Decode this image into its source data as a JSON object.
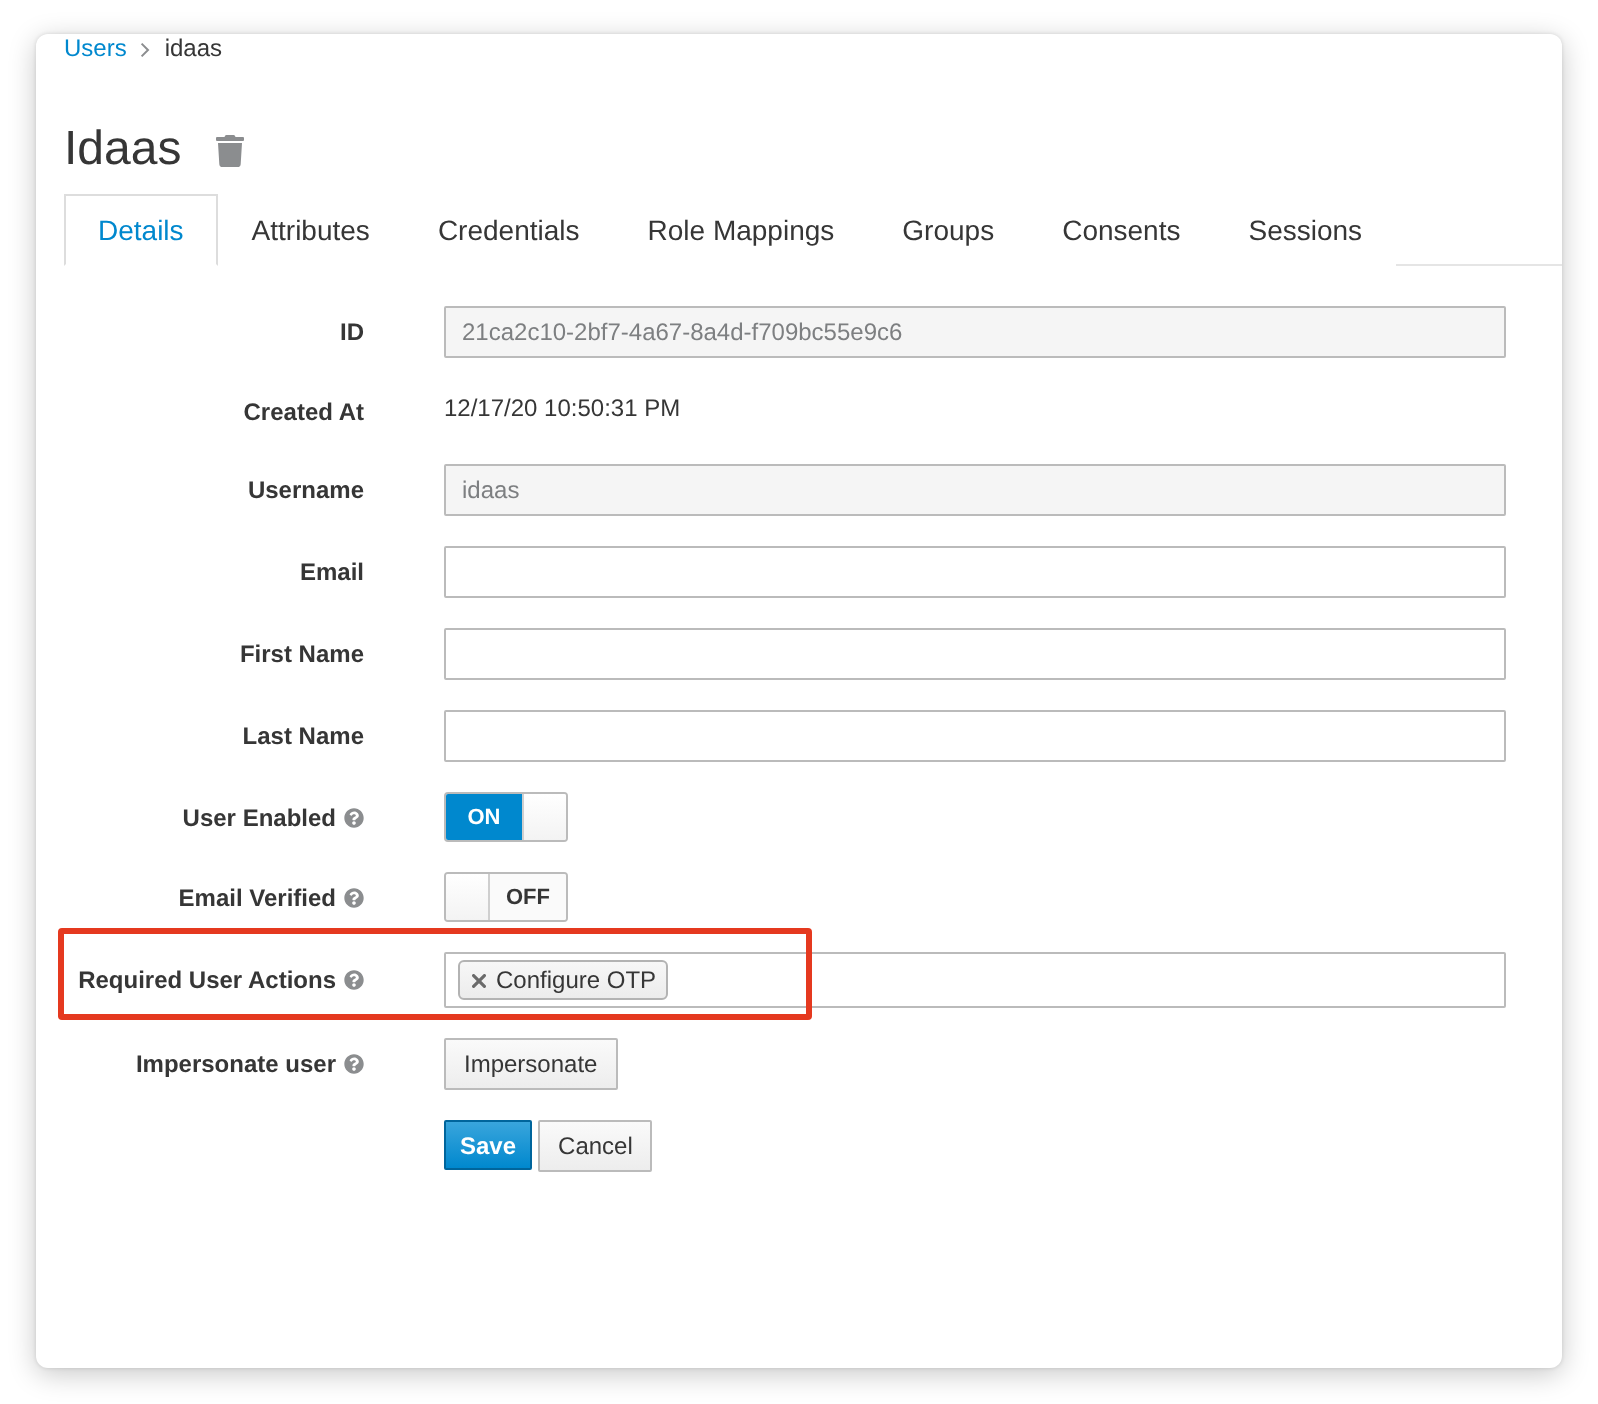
{
  "breadcrumb": [
    {
      "label": "Users",
      "kind": "link"
    },
    {
      "label": "idaas",
      "kind": "current"
    }
  ],
  "title": "Idaas",
  "tabs": [
    {
      "label": "Details",
      "selected": true
    },
    {
      "label": "Attributes",
      "selected": false
    },
    {
      "label": "Credentials",
      "selected": false
    },
    {
      "label": "Role Mappings",
      "selected": false
    },
    {
      "label": "Groups",
      "selected": false
    },
    {
      "label": "Consents",
      "selected": false
    },
    {
      "label": "Sessions",
      "selected": false
    }
  ],
  "fields": [
    {
      "kind": "readonly",
      "label": "ID",
      "value": "21ca2c10-2bf7-4a67-8a4d-f709bc55e9c6"
    },
    {
      "kind": "text",
      "label": "Created At",
      "value": "12/17/20 10:50:31 PM"
    },
    {
      "kind": "readonly",
      "label": "Username",
      "value": "idaas"
    },
    {
      "kind": "input",
      "label": "Email"
    },
    {
      "kind": "input",
      "label": "First Name"
    },
    {
      "kind": "input",
      "label": "Last Name"
    },
    {
      "kind": "switch",
      "label": "User Enabled",
      "help": true,
      "on": true,
      "state_label": "ON"
    },
    {
      "kind": "switch",
      "label": "Email Verified",
      "help": true,
      "on": false,
      "state_label": "OFF"
    },
    {
      "kind": "tags",
      "label": "Required User Actions",
      "help": true,
      "highlighted": true,
      "tags": [
        "Configure OTP"
      ]
    },
    {
      "kind": "button",
      "label": "Impersonate user",
      "help": true,
      "button": "Impersonate"
    }
  ],
  "actions": [
    {
      "kind": "primary",
      "label": "Save"
    },
    {
      "kind": "default",
      "label": "Cancel"
    }
  ]
}
